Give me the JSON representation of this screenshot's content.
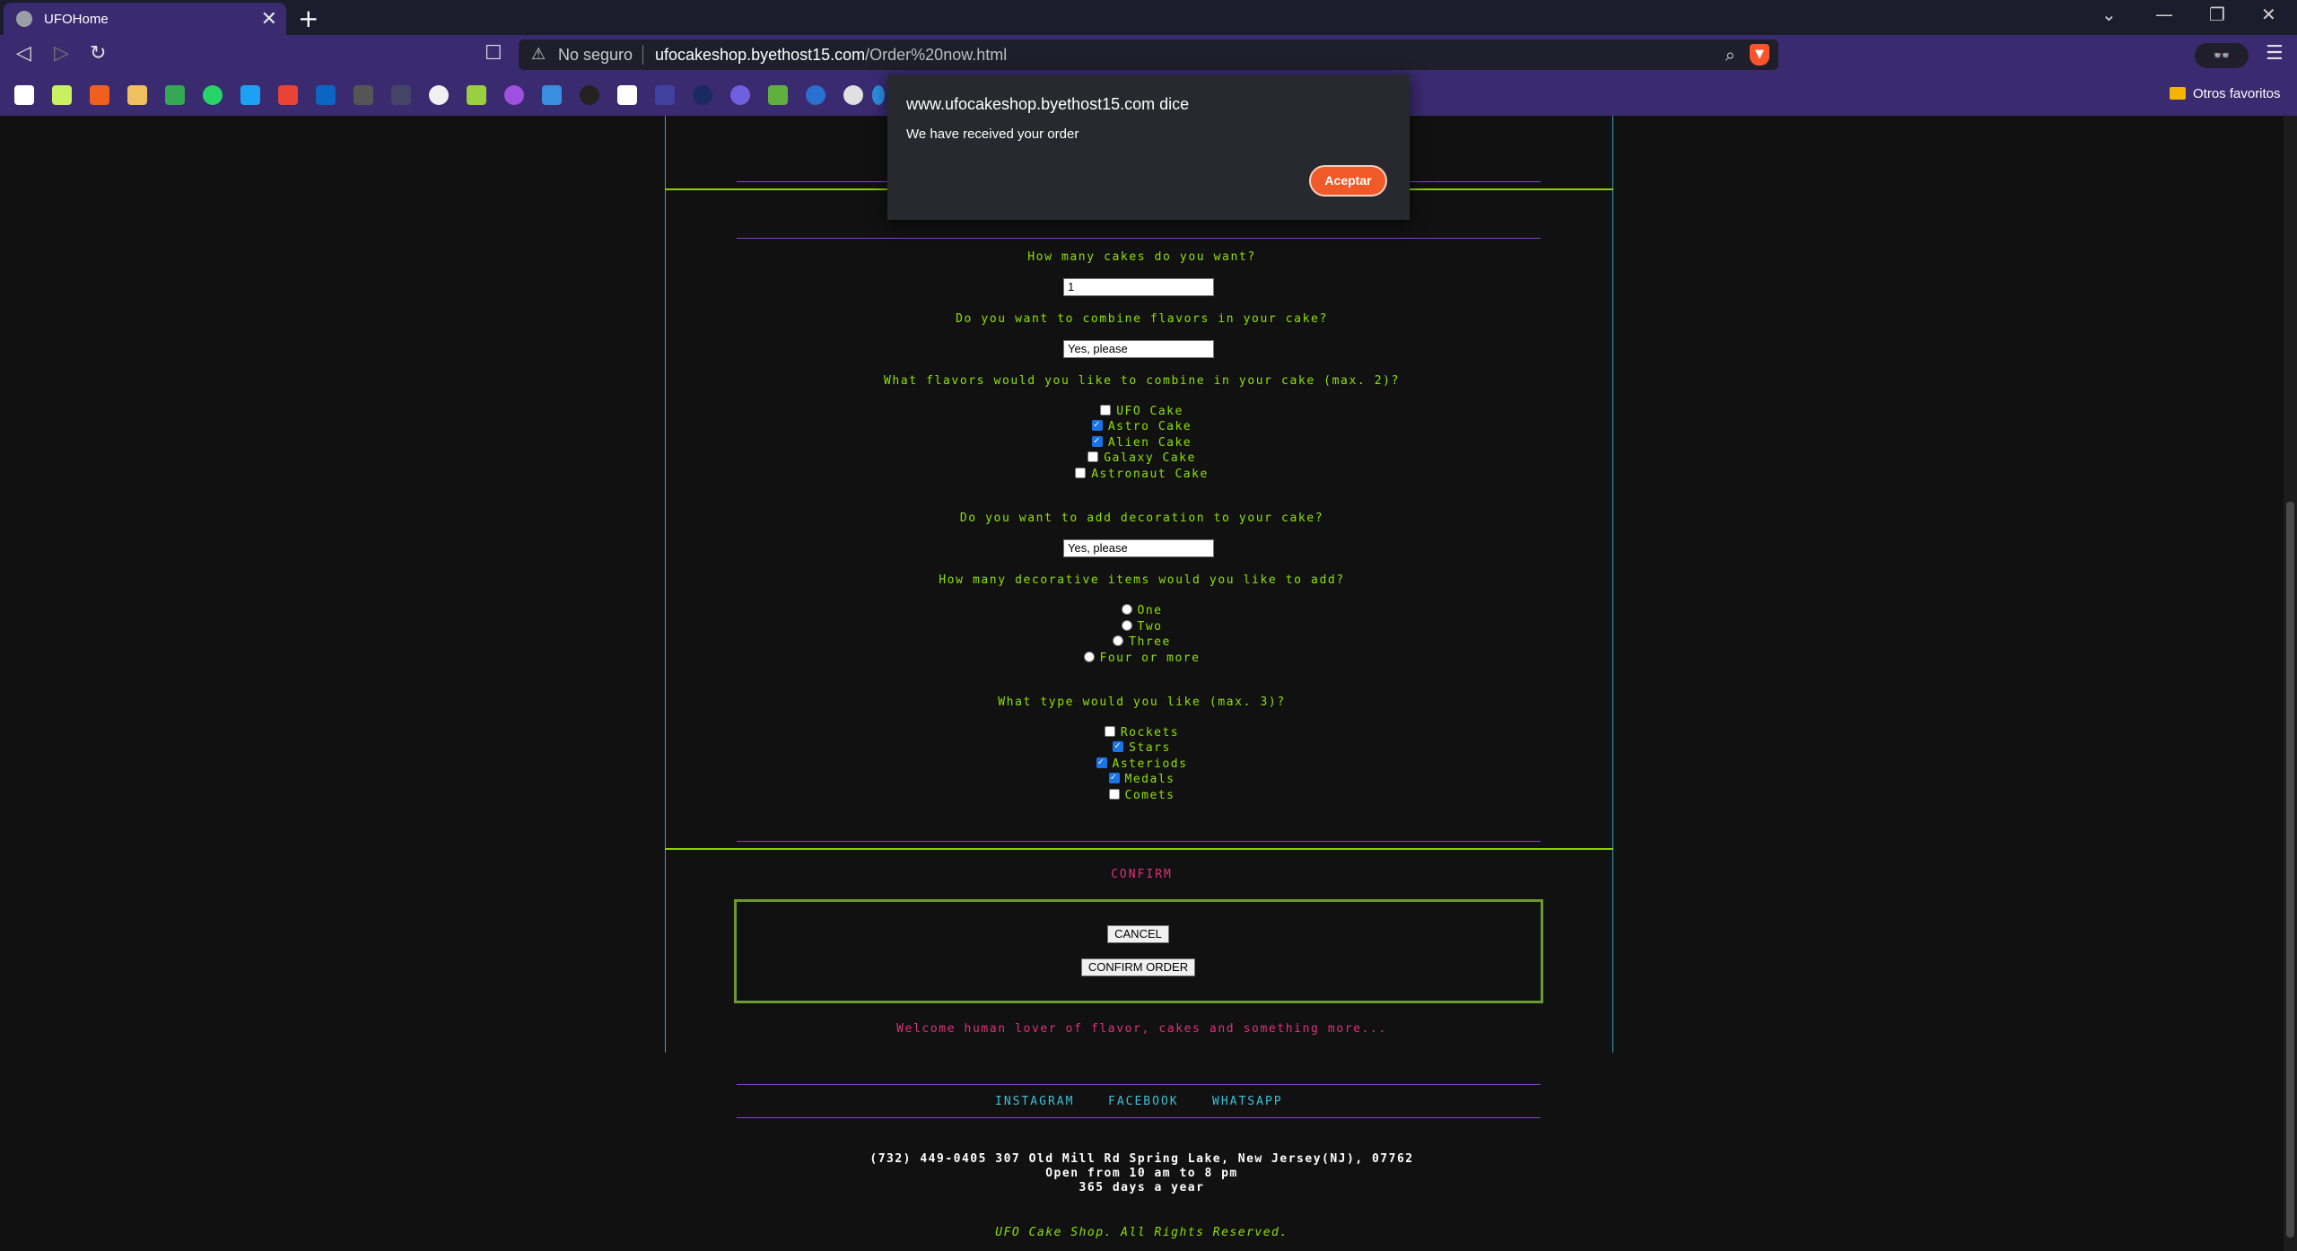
{
  "browser": {
    "tab_title": "UFOHome",
    "tab_close": "✕",
    "new_tab": "+",
    "address_security": "No seguro",
    "url_host": "ufocakeshop.byethost15.com",
    "url_path": "/Order%20now.html",
    "other_bookmarks": "Otros favoritos",
    "bookmark_icons": [
      "amazon-icon",
      "dribbble-icon",
      "slideshare-icon",
      "hamburger-icon",
      "maps-icon",
      "whatsapp-icon",
      "twitter-icon",
      "gmail-icon",
      "linkedin-icon",
      "tb-icon",
      "grid-icon",
      "github-icon",
      "diamond-icon",
      "u-icon",
      "r-icon",
      "a-icon",
      "notion-icon",
      "power-apps-icon",
      "circle-icon",
      "keepa-icon",
      "w-icon",
      "o-icon",
      "s-icon",
      "globe-icon"
    ]
  },
  "dialog": {
    "origin": "www.ufocakeshop.byethost15.com dice",
    "message": "We have received your order",
    "accept_label": "Aceptar"
  },
  "form": {
    "q_cakes": "How many cakes do you want?",
    "cakes_value": "1",
    "q_combine": "Do you want to combine flavors in your cake?",
    "combine_value": "Yes, please",
    "q_flavors": "What flavors would you like to combine in your cake (max. 2)?",
    "flavors": [
      {
        "label": "UFO Cake",
        "checked": false
      },
      {
        "label": "Astro Cake",
        "checked": true
      },
      {
        "label": "Alien Cake",
        "checked": true
      },
      {
        "label": "Galaxy Cake",
        "checked": false
      },
      {
        "label": "Astronaut Cake",
        "checked": false
      }
    ],
    "q_decoration": "Do you want to add decoration to your cake?",
    "decoration_value": "Yes, please",
    "q_items": "How many decorative items would you like to add?",
    "items": [
      "One",
      "Two",
      "Three",
      "Four or more"
    ],
    "q_type": "What type would you like (max. 3)?",
    "types": [
      {
        "label": "Rockets",
        "checked": false
      },
      {
        "label": "Stars",
        "checked": true
      },
      {
        "label": "Asteriods",
        "checked": true
      },
      {
        "label": "Medals",
        "checked": true
      },
      {
        "label": "Comets",
        "checked": false
      }
    ]
  },
  "confirm": {
    "title": "CONFIRM",
    "cancel_label": "CANCEL",
    "confirm_label": "CONFIRM ORDER",
    "welcome": "Welcome human lover of flavor, cakes and something more..."
  },
  "footer": {
    "social": [
      "INSTAGRAM",
      "FACEBOOK",
      "WHATSAPP"
    ],
    "address_line1": "(732) 449-0405 307 Old Mill Rd Spring Lake, New Jersey(NJ), 07762",
    "address_line2": "Open from 10 am to 8 pm",
    "address_line3": "365 days a year",
    "rights": "UFO Cake Shop. All Rights Reserved."
  },
  "colors": {
    "accent_green": "#8ee000",
    "accent_pink": "#e0307a",
    "accent_cyan": "#3ac0d8",
    "divider_purple": "#8a3fd0",
    "browser_purple": "#3a2a70",
    "dialog_button": "#f05a28"
  }
}
